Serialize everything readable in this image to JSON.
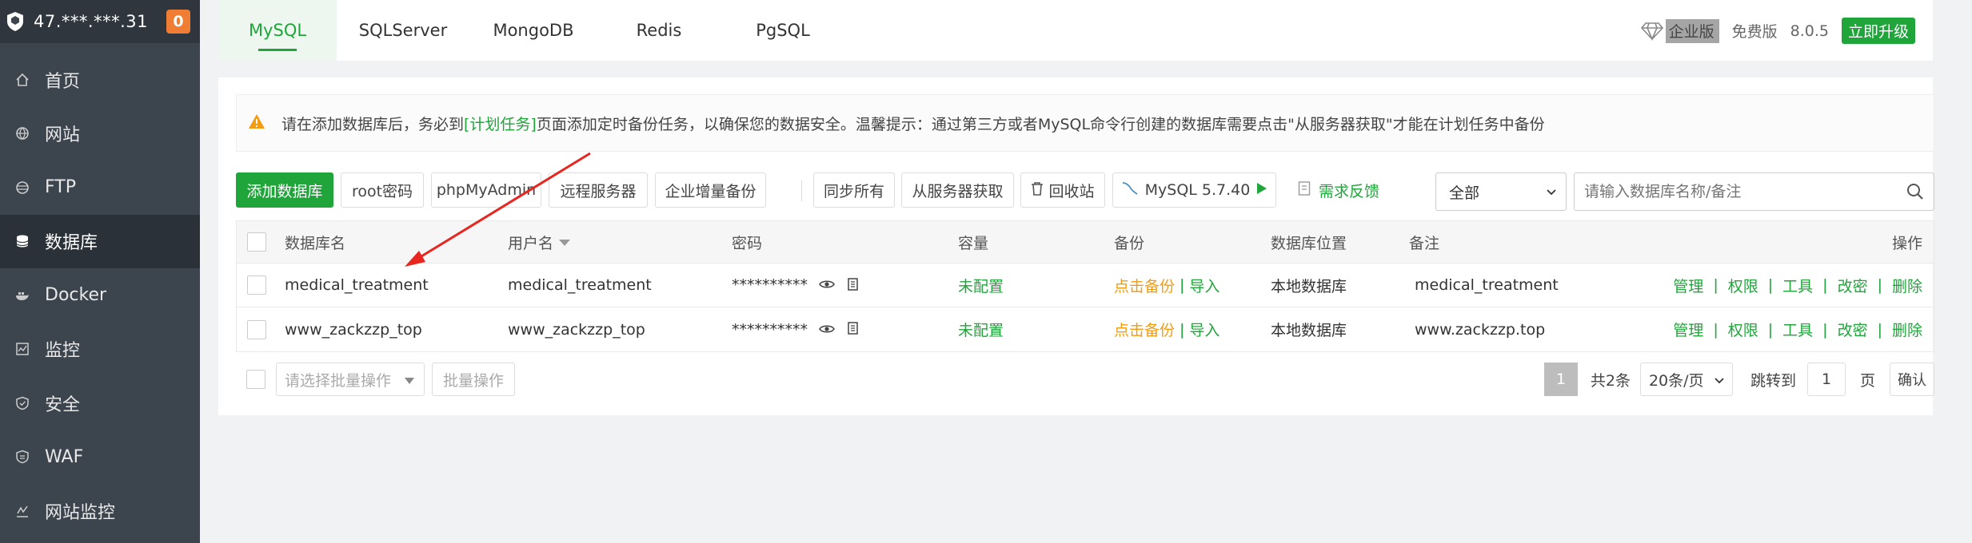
{
  "sidebar": {
    "host": "47.***.***.31",
    "badge": "0",
    "items": [
      {
        "label": "首页",
        "icon": "home-icon"
      },
      {
        "label": "网站",
        "icon": "globe-icon"
      },
      {
        "label": "FTP",
        "icon": "ftp-icon"
      },
      {
        "label": "数据库",
        "icon": "database-icon",
        "active": true
      },
      {
        "label": "Docker",
        "icon": "docker-icon"
      },
      {
        "label": "监控",
        "icon": "monitor-icon"
      },
      {
        "label": "安全",
        "icon": "shield-icon"
      },
      {
        "label": "WAF",
        "icon": "waf-icon"
      },
      {
        "label": "网站监控",
        "icon": "site-monitor-icon"
      }
    ]
  },
  "topbar": {
    "tabs": [
      "MySQL",
      "SQLServer",
      "MongoDB",
      "Redis",
      "PgSQL"
    ],
    "active_tab": "MySQL",
    "enterprise": "企业版",
    "free": "免费版",
    "version": "8.0.5",
    "upgrade": "立即升级"
  },
  "notice": {
    "before": "请在添加数据库后，务必到",
    "link": "[计划任务]",
    "after": "页面添加定时备份任务，以确保您的数据安全。温馨提示：通过第三方或者MySQL命令行创建的数据库需要点击\"从服务器获取\"才能在计划任务中备份"
  },
  "toolbar": {
    "add_db": "添加数据库",
    "root_pwd": "root密码",
    "phpmyadmin": "phpMyAdmin",
    "remote": "远程服务器",
    "incremental": "企业增量备份",
    "sync_all": "同步所有",
    "fetch": "从服务器获取",
    "recycle": "回收站",
    "mysql_version": "MySQL 5.7.40",
    "feedback": "需求反馈",
    "filter": "全部",
    "search_placeholder": "请输入数据库名称/备注"
  },
  "table": {
    "headers": {
      "name": "数据库名",
      "user": "用户名",
      "password": "密码",
      "capacity": "容量",
      "backup": "备份",
      "location": "数据库位置",
      "remark": "备注",
      "ops": "操作"
    },
    "rows": [
      {
        "name": "medical_treatment",
        "user": "medical_treatment",
        "password": "**********",
        "capacity": "未配置",
        "backup": "点击备份",
        "import": "导入",
        "location": "本地数据库",
        "remark": "medical_treatment"
      },
      {
        "name": "www_zackzzp_top",
        "user": "www_zackzzp_top",
        "password": "**********",
        "capacity": "未配置",
        "backup": "点击备份",
        "import": "导入",
        "location": "本地数据库",
        "remark": "www.zackzzp.top"
      }
    ],
    "ops": [
      "管理",
      "权限",
      "工具",
      "改密",
      "删除"
    ]
  },
  "footer": {
    "batch_placeholder": "请选择批量操作",
    "batch_button": "批量操作",
    "page": "1",
    "total": "共2条",
    "page_size": "20条/页",
    "jump_label": "跳转到",
    "jump_value": "1",
    "page_unit": "页",
    "confirm": "确认"
  },
  "colors": {
    "accent": "#20a53a",
    "warning": "#f39c12",
    "sidebar_bg": "#3c444d",
    "annotation": "#e8251f"
  }
}
